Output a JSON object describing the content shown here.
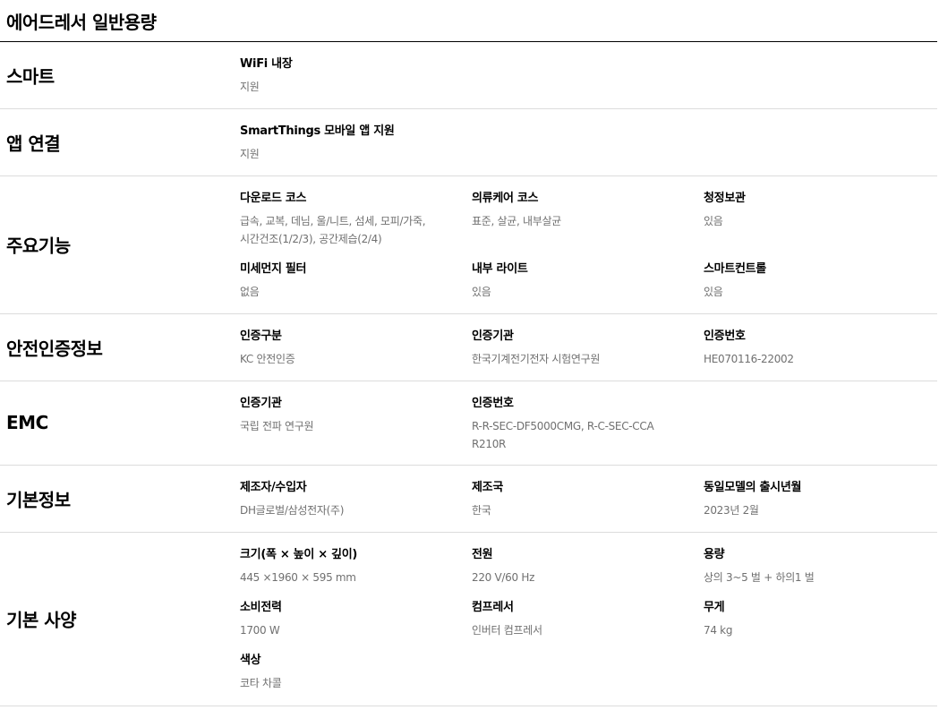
{
  "title": "에어드레서 일반용량",
  "sections": {
    "smart": {
      "title": "스마트",
      "items": [
        {
          "label": "WiFi 내장",
          "value": "지원"
        }
      ]
    },
    "app": {
      "title": "앱 연결",
      "items": [
        {
          "label": "SmartThings 모바일 앱 지원",
          "value": "지원"
        }
      ]
    },
    "features": {
      "title": "주요기능",
      "items": [
        {
          "label": "다운로드 코스",
          "value": "급속, 교복, 데님, 울/니트, 섬세, 모피/가죽, 시간건조(1/2/3), 공간제습(2/4)"
        },
        {
          "label": "의류케어 코스",
          "value": "표준, 살균, 내부살균"
        },
        {
          "label": "청정보관",
          "value": "있음"
        },
        {
          "label": "미세먼지 필터",
          "value": "없음"
        },
        {
          "label": "내부 라이트",
          "value": "있음"
        },
        {
          "label": "스마트컨트롤",
          "value": "있음"
        }
      ]
    },
    "safety": {
      "title": "안전인증정보",
      "items": [
        {
          "label": "인증구분",
          "value": "KC 안전인증"
        },
        {
          "label": "인증기관",
          "value": "한국기계전기전자 시험연구원"
        },
        {
          "label": "인증번호",
          "value": "HE070116-22002"
        }
      ]
    },
    "emc": {
      "title": "EMC",
      "items": [
        {
          "label": "인증기관",
          "value": "국립 전파 연구원"
        },
        {
          "label": "인증번호",
          "value": "R-R-SEC-DF5000CMG, R-C-SEC-CCAR210R"
        }
      ]
    },
    "basic": {
      "title": "기본정보",
      "items": [
        {
          "label": "제조자/수입자",
          "value": "DH글로벌/삼성전자(주)"
        },
        {
          "label": "제조국",
          "value": "한국"
        },
        {
          "label": "동일모델의 출시년월",
          "value": "2023년 2월"
        }
      ]
    },
    "spec": {
      "title": "기본 사양",
      "items": [
        {
          "label": "크기(폭 × 높이 × 깊이)",
          "value": "445 ×1960 × 595 mm"
        },
        {
          "label": "전원",
          "value": "220 V/60 Hz"
        },
        {
          "label": "용량",
          "value": "상의 3~5 벌 + 하의1 벌"
        },
        {
          "label": "소비전력",
          "value": "1700 W"
        },
        {
          "label": "컴프레서",
          "value": "인버터 컴프레서"
        },
        {
          "label": "무게",
          "value": "74 kg"
        },
        {
          "label": "색상",
          "value": "코타 차콜"
        }
      ]
    }
  }
}
